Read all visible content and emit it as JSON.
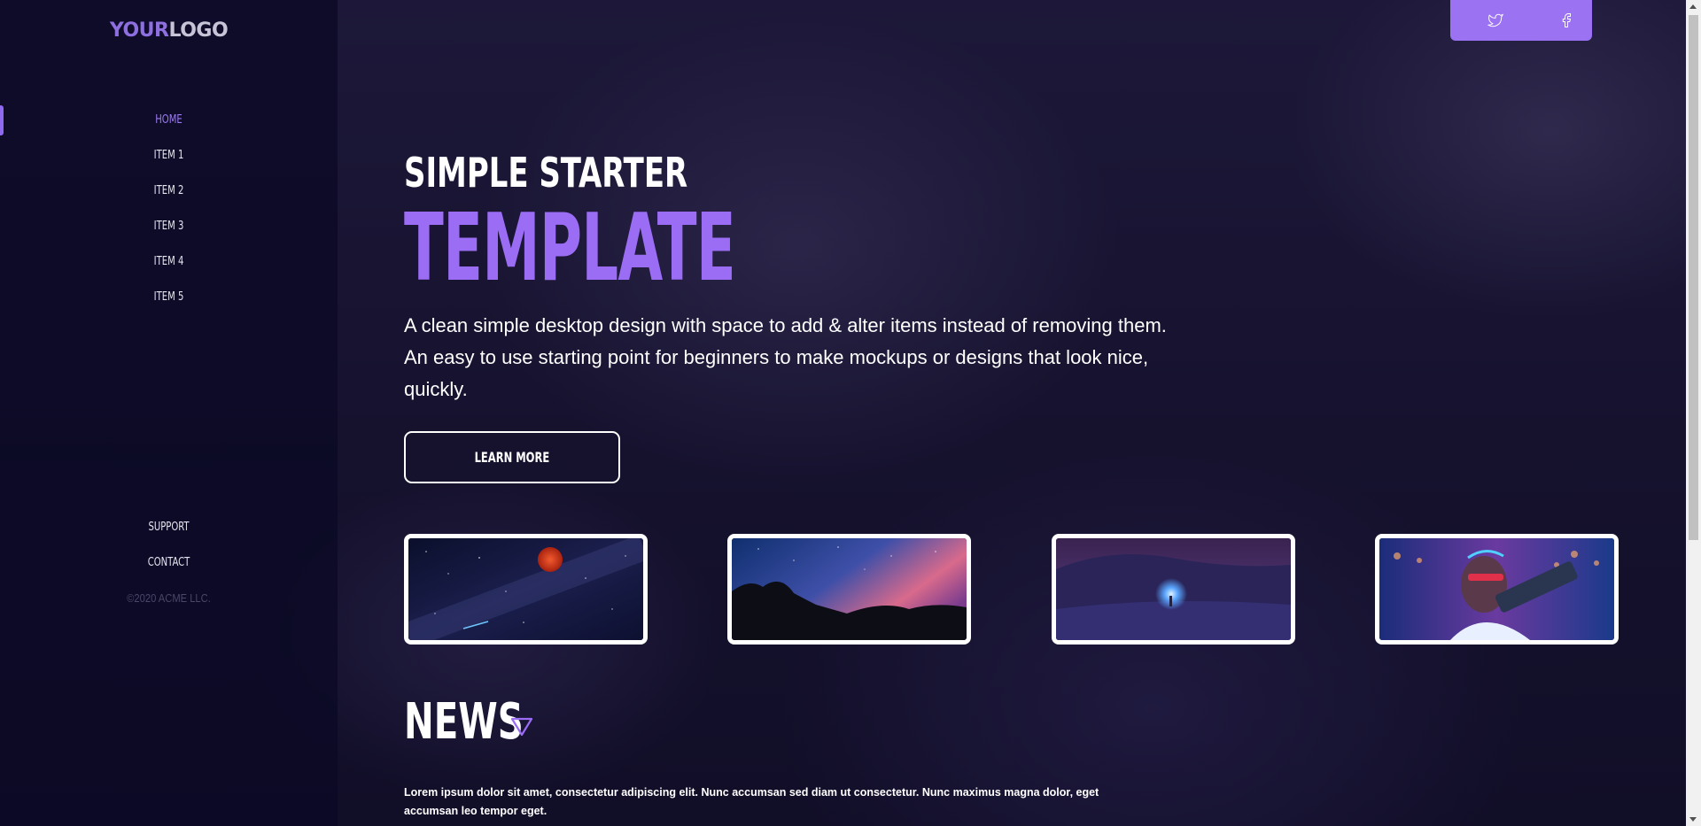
{
  "sidebar": {
    "logo": {
      "part1": "YOUR",
      "part2": "LOGO"
    },
    "nav": [
      {
        "label": "HOME",
        "active": true
      },
      {
        "label": "ITEM 1"
      },
      {
        "label": "ITEM 2"
      },
      {
        "label": "ITEM 3"
      },
      {
        "label": "ITEM 4"
      },
      {
        "label": "ITEM 5"
      }
    ],
    "footer_links": [
      "SUPPORT",
      "CONTACT"
    ],
    "copyright": "©2020 ACME LLC."
  },
  "social": {
    "icons": [
      "twitter-icon",
      "facebook-icon"
    ]
  },
  "hero": {
    "subtitle": "SIMPLE STARTER",
    "title": "TEMPLATE",
    "description": "A clean simple desktop design with space to add & alter items instead of removing them. An easy to use starting point for beginners to make mockups or designs that look nice, quickly.",
    "button_label": "LEARN MORE"
  },
  "thumbnails": [
    {
      "name": "space-moon-image"
    },
    {
      "name": "night-sky-rocks-image"
    },
    {
      "name": "snow-night-light-image"
    },
    {
      "name": "neon-portrait-image"
    }
  ],
  "news": {
    "title": "NEWS",
    "text": "Lorem ipsum dolor sit amet, consectetur adipiscing elit. Nunc accumsan sed diam ut consectetur. Nunc maximus magna dolor, eget accumsan leo tempor eget."
  },
  "colors": {
    "accent": "#9b6cf4",
    "background": "#161233",
    "sidebar": "#0a0824"
  }
}
